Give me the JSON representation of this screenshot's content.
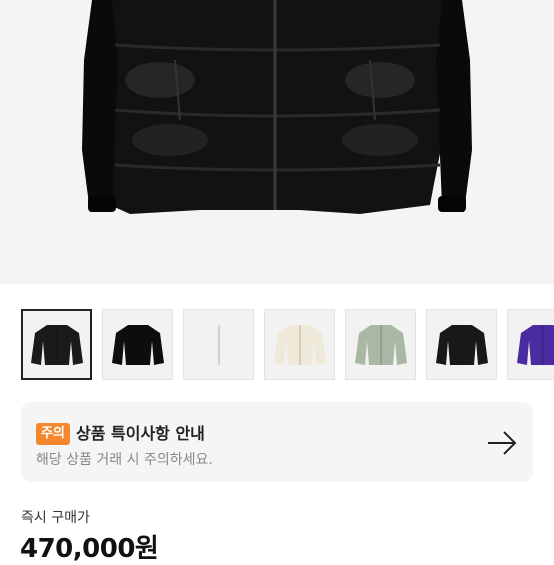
{
  "product": {
    "thumbnails": [
      {
        "id": "black",
        "color": "#1a1a1a",
        "selected": true
      },
      {
        "id": "shiny-black",
        "color": "#0d0d0d",
        "selected": false
      },
      {
        "id": "white",
        "color": "#f1f1f1",
        "selected": false
      },
      {
        "id": "cream",
        "color": "#efe9d9",
        "selected": false
      },
      {
        "id": "sage",
        "color": "#a8b8a4",
        "selected": false
      },
      {
        "id": "black-2",
        "color": "#181818",
        "selected": false
      },
      {
        "id": "purple",
        "color": "#4b2ca0",
        "selected": false
      }
    ]
  },
  "notice": {
    "badge": "주의",
    "title": "상품 특이사항 안내",
    "subtitle": "해당 상품 거래 시 주의하세요."
  },
  "purchase": {
    "label": "즉시 구매가",
    "price": "470,000원"
  }
}
